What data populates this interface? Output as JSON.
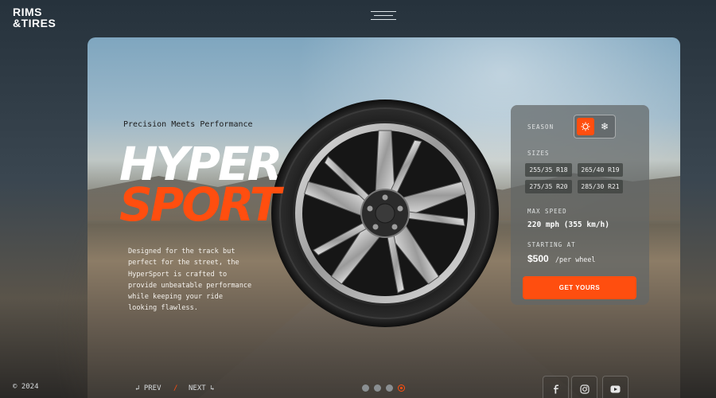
{
  "brand": {
    "line1": "RIMS",
    "line2": "&TIRES"
  },
  "hero": {
    "tagline": "Precision Meets Performance",
    "title_line1": "HYPER",
    "title_line2": "SPORT",
    "description": "Designed for the track but perfect for the street, the HyperSport is crafted to provide unbeatable performance while keeping your ride looking flawless."
  },
  "panel": {
    "season_label": "SEASON",
    "season_options": [
      "summer-icon",
      "winter-icon"
    ],
    "season_selected": "summer",
    "sizes_label": "SIZES",
    "sizes": [
      "255/35 R18",
      "265/40 R19",
      "275/35 R20",
      "285/30 R21"
    ],
    "max_speed_label": "MAX SPEED",
    "max_speed_value": "220 mph (355 km/h)",
    "starting_at_label": "STARTING AT",
    "price": "$500",
    "price_suffix": "/per wheel",
    "cta_label": "GET YOURS"
  },
  "footer": {
    "copyright": "© 2024",
    "prev_label": "↲ PREV",
    "separator": "/",
    "next_label": "NEXT ↳",
    "slides_total": 4,
    "slide_active": 4,
    "social": [
      "facebook-icon",
      "instagram-icon",
      "youtube-icon"
    ]
  },
  "colors": {
    "accent": "#ff4e0f",
    "panel": "#62666699",
    "text": "#ffffff"
  }
}
